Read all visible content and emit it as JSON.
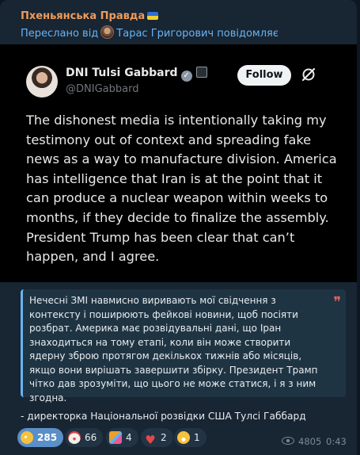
{
  "message": {
    "channel_name": "Пхеньянська Правда",
    "forward_prefix": "Переслано від",
    "forward_source": "Тарас Григорович повідомляє",
    "tweet": {
      "author_name": "DNI Tulsi Gabbard",
      "author_handle": "@DNIGabbard",
      "follow_label": "Follow",
      "text": "The dishonest media is intentionally taking my testimony out of context and spreading fake news as a way to manufacture division. America has intelligence that Iran is at the point that it can produce a nuclear weapon within weeks to months, if they decide to finalize the assembly. President Trump has been clear that can’t happen, and I agree."
    },
    "quote_text": "Нечесні ЗМІ навмисно виривають мої свідчення з контексту і поширюють фейкові новини, щоб посіяти розбрат. Америка має розвідувальні дані, що Іран знаходиться на тому етапі, коли він може створити ядерну зброю протягом декількох тижнів або місяців, якщо вони вирішать завершити збірку. Президент Трамп чітко дав зрозуміти, що цього не може статися, і я з ним згодна.",
    "signature": "- директорка Національної розвідки США Тулсі Габбард",
    "reactions": [
      {
        "icon": "rofl-emoji-icon",
        "count": "285"
      },
      {
        "icon": "clown-emoji-icon",
        "count": "66"
      },
      {
        "icon": "party-popper-emoji-icon",
        "count": "4"
      },
      {
        "icon": "heart-emoji-icon",
        "count": "2"
      },
      {
        "icon": "grin-emoji-icon",
        "count": "1"
      }
    ],
    "views": "4805",
    "time": "0:43"
  },
  "colors": {
    "background": "#0e1621",
    "bubble": "#182533",
    "channel_name": "#ef9b5a",
    "link": "#6ab3f3",
    "quote_bg": "#1f3443",
    "reaction_active": "#5a8fc7",
    "tweet_bg": "#000000"
  }
}
